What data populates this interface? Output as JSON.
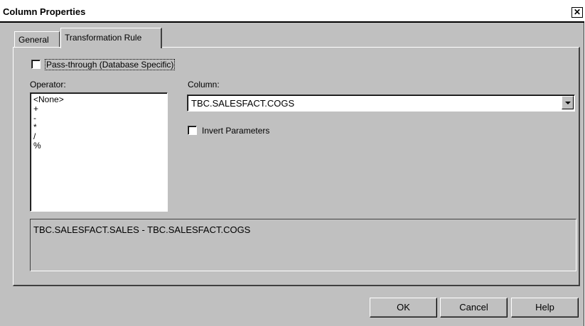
{
  "window": {
    "title": "Column Properties",
    "close_glyph": "✕"
  },
  "tabs": [
    {
      "label": "General",
      "active": false
    },
    {
      "label": "Transformation Rule",
      "active": true
    }
  ],
  "passthrough": {
    "label": "Pass-through (Database Specific)",
    "checked": false
  },
  "operator": {
    "label": "Operator:",
    "items": [
      "<None>",
      "+",
      "-",
      "*",
      "/",
      "%"
    ]
  },
  "column": {
    "label": "Column:",
    "value": "TBC.SALESFACT.COGS"
  },
  "invert": {
    "label": "Invert Parameters",
    "checked": false
  },
  "expression": {
    "text": "TBC.SALESFACT.SALES - TBC.SALESFACT.COGS"
  },
  "buttons": {
    "ok": "OK",
    "cancel": "Cancel",
    "help": "Help"
  },
  "colors": {
    "face": "#c0c0c0",
    "window": "#ffffff",
    "title_text": "#000000"
  }
}
